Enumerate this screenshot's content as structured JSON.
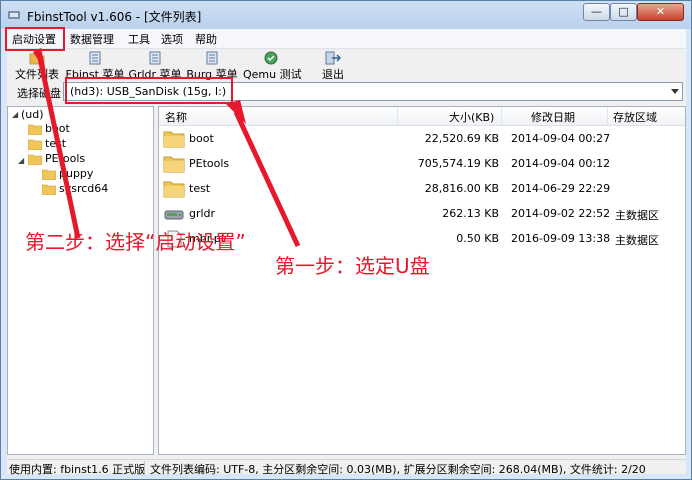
{
  "window": {
    "title": "FbinstTool v1.606 - [文件列表]",
    "title_blurred_suffix": "",
    "controls": {
      "minimize": "—",
      "maximize": "□",
      "close": "✕"
    }
  },
  "menu": [
    "启动设置",
    "数据管理",
    "工具",
    "选项",
    "帮助"
  ],
  "toolbar": [
    {
      "label": "文件列表",
      "icon": "file-list-icon"
    },
    {
      "label": "Fbinst 菜单",
      "icon": "fbinst-menu-icon"
    },
    {
      "label": "Grldr 菜单",
      "icon": "grldr-menu-icon"
    },
    {
      "label": "Burg 菜单",
      "icon": "burg-menu-icon"
    },
    {
      "label": "Qemu 测试",
      "icon": "qemu-test-icon"
    },
    {
      "label": "退出",
      "icon": "exit-icon"
    }
  ],
  "drive": {
    "label": "选择磁盘",
    "selected": "(hd3): USB_SanDisk (15g, I:)"
  },
  "tree": {
    "root": "(ud)",
    "items": [
      "boot",
      "test",
      "PEtools",
      "puppy",
      "sysrcd64"
    ]
  },
  "list": {
    "columns": [
      "名称",
      "大小(KB)",
      "修改日期",
      "存放区域"
    ],
    "rows": [
      {
        "name": "boot",
        "size": "22,520.69 KB",
        "date": "2014-09-04 00:27",
        "area": "",
        "type": "folder"
      },
      {
        "name": "PEtools",
        "size": "705,574.19 KB",
        "date": "2014-09-04 00:12",
        "area": "",
        "type": "folder"
      },
      {
        "name": "test",
        "size": "28,816.00 KB",
        "date": "2014-06-29 22:29",
        "area": "",
        "type": "folder"
      },
      {
        "name": "grldr",
        "size": "262.13 KB",
        "date": "2014-09-02 22:52",
        "area": "主数据区",
        "type": "drive-file"
      },
      {
        "name": "mbr.pt",
        "size": "0.50 KB",
        "date": "2016-09-09 13:38",
        "area": "主数据区",
        "type": "file"
      }
    ]
  },
  "status": {
    "left": "使用内置: fbinst1.6 正式版",
    "right": "文件列表编码: UTF-8, 主分区剩余空间: 0.03(MB), 扩展分区剩余空间: 268.04(MB), 文件统计: 2/20"
  },
  "annotations": {
    "step1": "第一步：选定U盘",
    "step2": "第二步：选择“启动设置”",
    "color": "#e8182c"
  }
}
